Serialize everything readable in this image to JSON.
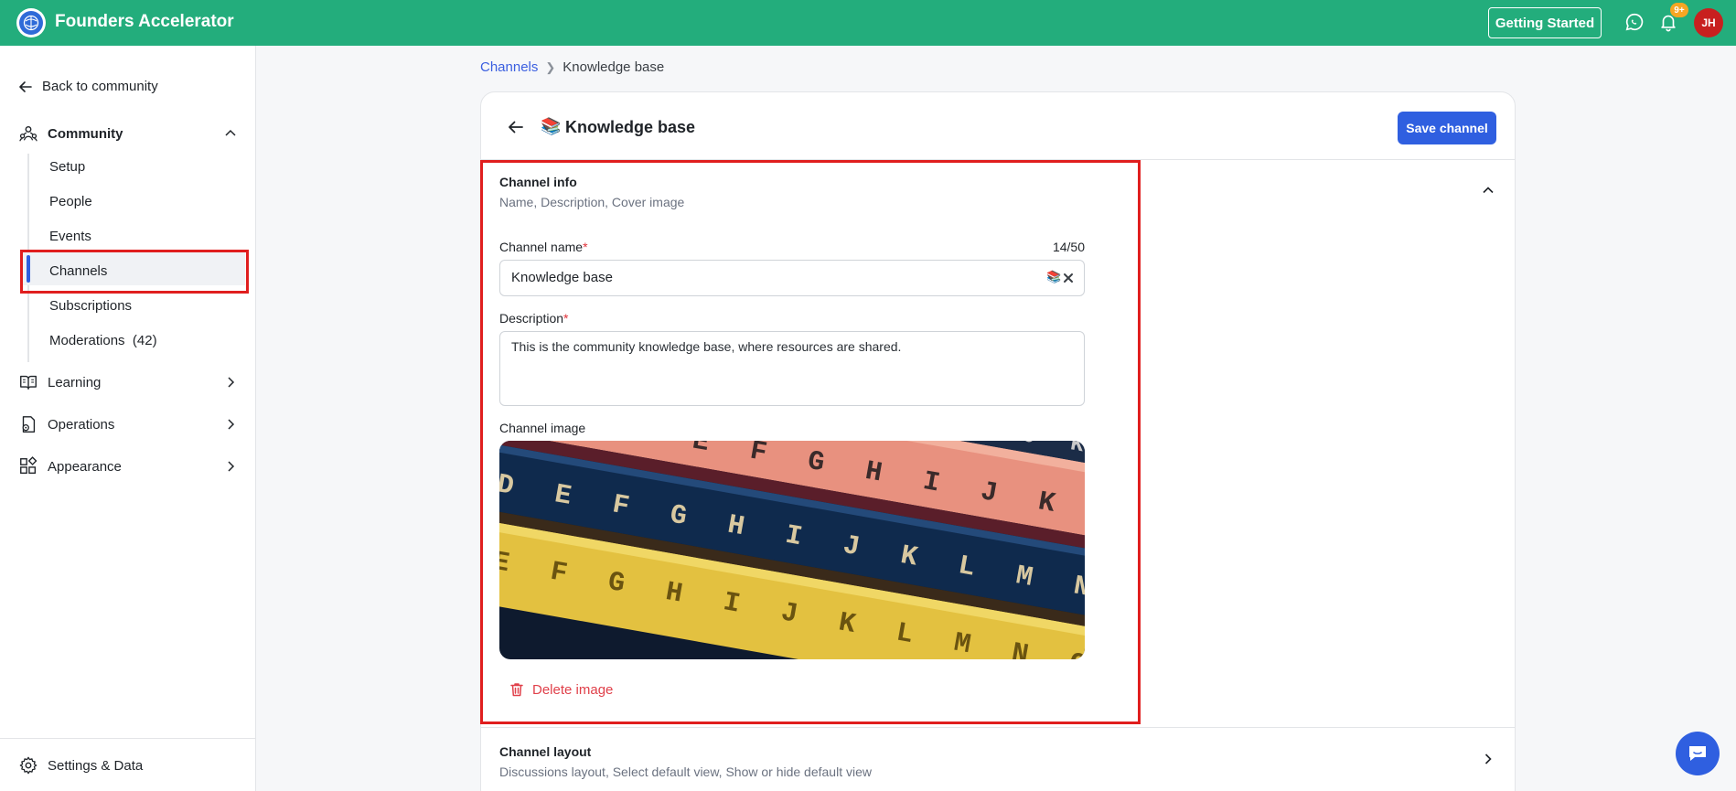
{
  "topbar": {
    "brand": "Founders Accelerator",
    "getting_started": "Getting Started",
    "notification_count": "9+",
    "avatar_initials": "JH"
  },
  "sidebar": {
    "back": "Back to community",
    "community": "Community",
    "community_items": [
      {
        "label": "Setup"
      },
      {
        "label": "People"
      },
      {
        "label": "Events"
      },
      {
        "label": "Channels"
      },
      {
        "label": "Subscriptions"
      },
      {
        "label": "Moderations",
        "count": "(42)"
      }
    ],
    "learning": "Learning",
    "operations": "Operations",
    "appearance": "Appearance",
    "settings": "Settings & Data"
  },
  "breadcrumb": {
    "parent": "Channels",
    "current": "Knowledge base"
  },
  "card": {
    "title_emoji": "📚",
    "title": "Knowledge base",
    "save": "Save channel"
  },
  "channel_info": {
    "title": "Channel info",
    "subtitle": "Name, Description, Cover image",
    "name_label": "Channel name",
    "required_mark": "*",
    "name_counter": "14/50",
    "name_value": "Knowledge base",
    "name_emoji": "📚",
    "description_label": "Description",
    "description_value": "This is the community knowledge base, where resources are shared.",
    "image_label": "Channel image",
    "delete_image": "Delete image",
    "pencil_rows": [
      {
        "color": "#e8917f",
        "letters": "B C D E F G H I J K"
      },
      {
        "color": "#0f2a4d",
        "letters": "D E F G H I J K L M N"
      },
      {
        "color": "#e3c140",
        "letters": "E F G H I J K L M N O"
      }
    ],
    "pencil_top_letters": "D E F G H I J K"
  },
  "channel_layout": {
    "title": "Channel layout",
    "subtitle": "Discussions layout, Select default view, Show or hide default view"
  }
}
